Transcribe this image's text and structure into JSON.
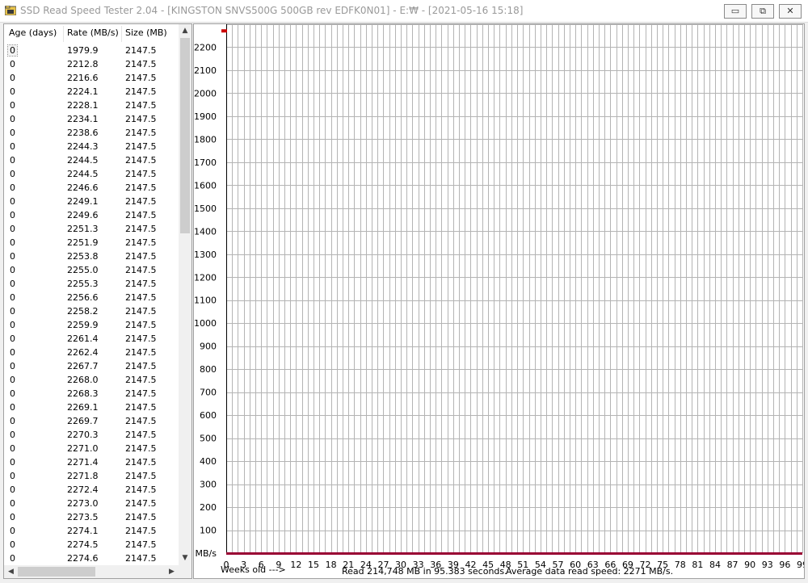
{
  "window": {
    "title": "SSD Read Speed Tester 2.04 - [KINGSTON SNVS500G 500GB rev EDFK0N01] - E:₩ - [2021-05-16 15:18]",
    "buttons": {
      "minimize": "▭",
      "maximize": "⧉",
      "close": "✕"
    }
  },
  "list": {
    "headers": {
      "age": "Age (days)",
      "rate": "Rate (MB/s)",
      "size": "Size (MB)"
    },
    "rows": [
      {
        "age": "0",
        "rate": "1979.9",
        "size": "2147.5"
      },
      {
        "age": "0",
        "rate": "2212.8",
        "size": "2147.5"
      },
      {
        "age": "0",
        "rate": "2216.6",
        "size": "2147.5"
      },
      {
        "age": "0",
        "rate": "2224.1",
        "size": "2147.5"
      },
      {
        "age": "0",
        "rate": "2228.1",
        "size": "2147.5"
      },
      {
        "age": "0",
        "rate": "2234.1",
        "size": "2147.5"
      },
      {
        "age": "0",
        "rate": "2238.6",
        "size": "2147.5"
      },
      {
        "age": "0",
        "rate": "2244.3",
        "size": "2147.5"
      },
      {
        "age": "0",
        "rate": "2244.5",
        "size": "2147.5"
      },
      {
        "age": "0",
        "rate": "2244.5",
        "size": "2147.5"
      },
      {
        "age": "0",
        "rate": "2246.6",
        "size": "2147.5"
      },
      {
        "age": "0",
        "rate": "2249.1",
        "size": "2147.5"
      },
      {
        "age": "0",
        "rate": "2249.6",
        "size": "2147.5"
      },
      {
        "age": "0",
        "rate": "2251.3",
        "size": "2147.5"
      },
      {
        "age": "0",
        "rate": "2251.9",
        "size": "2147.5"
      },
      {
        "age": "0",
        "rate": "2253.8",
        "size": "2147.5"
      },
      {
        "age": "0",
        "rate": "2255.0",
        "size": "2147.5"
      },
      {
        "age": "0",
        "rate": "2255.3",
        "size": "2147.5"
      },
      {
        "age": "0",
        "rate": "2256.6",
        "size": "2147.5"
      },
      {
        "age": "0",
        "rate": "2258.2",
        "size": "2147.5"
      },
      {
        "age": "0",
        "rate": "2259.9",
        "size": "2147.5"
      },
      {
        "age": "0",
        "rate": "2261.4",
        "size": "2147.5"
      },
      {
        "age": "0",
        "rate": "2262.4",
        "size": "2147.5"
      },
      {
        "age": "0",
        "rate": "2267.7",
        "size": "2147.5"
      },
      {
        "age": "0",
        "rate": "2268.0",
        "size": "2147.5"
      },
      {
        "age": "0",
        "rate": "2268.3",
        "size": "2147.5"
      },
      {
        "age": "0",
        "rate": "2269.1",
        "size": "2147.5"
      },
      {
        "age": "0",
        "rate": "2269.7",
        "size": "2147.5"
      },
      {
        "age": "0",
        "rate": "2270.3",
        "size": "2147.5"
      },
      {
        "age": "0",
        "rate": "2271.0",
        "size": "2147.5"
      },
      {
        "age": "0",
        "rate": "2271.4",
        "size": "2147.5"
      },
      {
        "age": "0",
        "rate": "2271.8",
        "size": "2147.5"
      },
      {
        "age": "0",
        "rate": "2272.4",
        "size": "2147.5"
      },
      {
        "age": "0",
        "rate": "2273.0",
        "size": "2147.5"
      },
      {
        "age": "0",
        "rate": "2273.5",
        "size": "2147.5"
      },
      {
        "age": "0",
        "rate": "2274.1",
        "size": "2147.5"
      },
      {
        "age": "0",
        "rate": "2274.5",
        "size": "2147.5"
      },
      {
        "age": "0",
        "rate": "2274.6",
        "size": "2147.5"
      }
    ]
  },
  "chart_data": {
    "type": "scatter",
    "ylabel": "MB/s",
    "xlabel": "Weeks old --->",
    "ylim": [
      0,
      2300
    ],
    "xlim": [
      0,
      99
    ],
    "y_ticks": [
      2200,
      2100,
      2000,
      1900,
      1800,
      1700,
      1600,
      1500,
      1400,
      1300,
      1200,
      1100,
      1000,
      900,
      800,
      700,
      600,
      500,
      400,
      300,
      200,
      100
    ],
    "x_ticks": [
      "0",
      "3",
      "6",
      "9",
      "12",
      "15",
      "18",
      "21",
      "24",
      "27",
      "30",
      "33",
      "36",
      "39",
      "42",
      "45",
      "48",
      "51",
      "54",
      "57",
      "60",
      "63",
      "66",
      "69",
      "72",
      "75",
      "78",
      "81",
      "84",
      "87",
      "90",
      "93",
      "96",
      "99"
    ],
    "grid": true,
    "points": [
      {
        "x": 0,
        "y": 2271
      }
    ],
    "colors": {
      "point": "#cc0000",
      "baseline": "#990033",
      "grid": "#b4b4b4"
    }
  },
  "status": {
    "read": "Read 214,748 MB in 95.383 seconds.",
    "average": "Average data read speed: 2271 MB/s."
  }
}
